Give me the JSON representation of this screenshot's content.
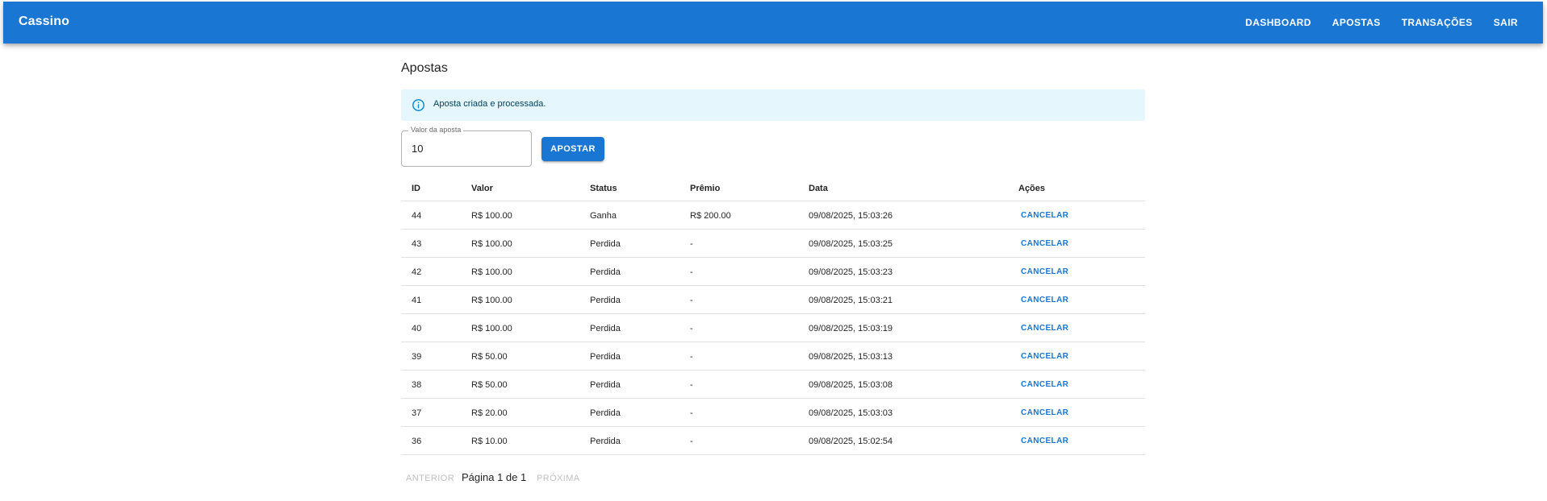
{
  "appbar": {
    "brand": "Cassino",
    "nav": [
      "DASHBOARD",
      "APOSTAS",
      "TRANSAÇÕES",
      "SAIR"
    ],
    "color": "#1976d2"
  },
  "page": {
    "title": "Apostas"
  },
  "alert": {
    "icon": "info-icon",
    "message": "Aposta criada e processada.",
    "background": "#e5f6fd"
  },
  "bet_form": {
    "field_label": "Valor da aposta",
    "field_value": "10",
    "submit_label": "APOSTAR"
  },
  "table": {
    "headers": {
      "id": "ID",
      "valor": "Valor",
      "status": "Status",
      "premio": "Prêmio",
      "data": "Data",
      "acoes": "Ações"
    },
    "rows": [
      {
        "id": "44",
        "valor": "R$ 100.00",
        "status": "Ganha",
        "premio": "R$ 200.00",
        "data": "09/08/2025, 15:03:26",
        "action": "CANCELAR"
      },
      {
        "id": "43",
        "valor": "R$ 100.00",
        "status": "Perdida",
        "premio": "-",
        "data": "09/08/2025, 15:03:25",
        "action": "CANCELAR"
      },
      {
        "id": "42",
        "valor": "R$ 100.00",
        "status": "Perdida",
        "premio": "-",
        "data": "09/08/2025, 15:03:23",
        "action": "CANCELAR"
      },
      {
        "id": "41",
        "valor": "R$ 100.00",
        "status": "Perdida",
        "premio": "-",
        "data": "09/08/2025, 15:03:21",
        "action": "CANCELAR"
      },
      {
        "id": "40",
        "valor": "R$ 100.00",
        "status": "Perdida",
        "premio": "-",
        "data": "09/08/2025, 15:03:19",
        "action": "CANCELAR"
      },
      {
        "id": "39",
        "valor": "R$ 50.00",
        "status": "Perdida",
        "premio": "-",
        "data": "09/08/2025, 15:03:13",
        "action": "CANCELAR"
      },
      {
        "id": "38",
        "valor": "R$ 50.00",
        "status": "Perdida",
        "premio": "-",
        "data": "09/08/2025, 15:03:08",
        "action": "CANCELAR"
      },
      {
        "id": "37",
        "valor": "R$ 20.00",
        "status": "Perdida",
        "premio": "-",
        "data": "09/08/2025, 15:03:03",
        "action": "CANCELAR"
      },
      {
        "id": "36",
        "valor": "R$ 10.00",
        "status": "Perdida",
        "premio": "-",
        "data": "09/08/2025, 15:02:54",
        "action": "CANCELAR"
      }
    ]
  },
  "pagination": {
    "prev_label": "ANTERIOR",
    "page_label": "Página 1 de 1",
    "next_label": "PRÓXIMA"
  }
}
